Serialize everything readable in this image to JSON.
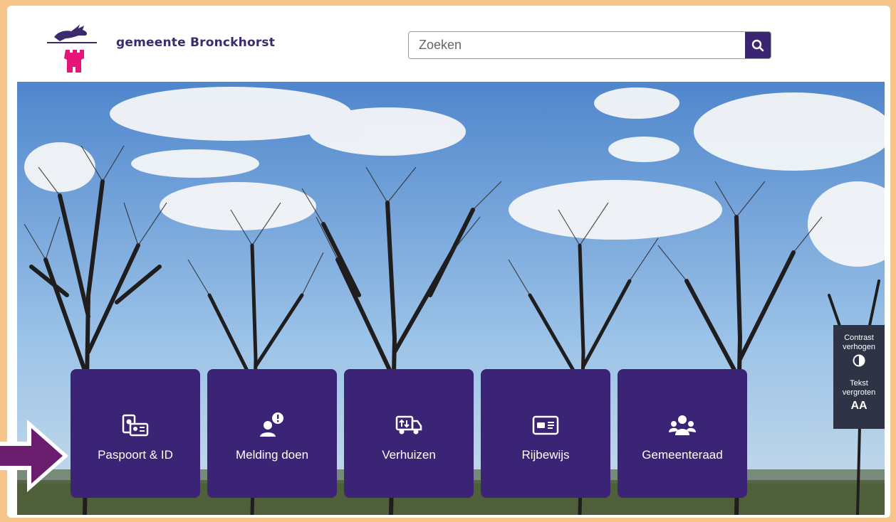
{
  "header": {
    "brand": "gemeente Bronckhorst",
    "search_placeholder": "Zoeken",
    "search_button_label": "Zoeken"
  },
  "tiles": [
    {
      "label": "Paspoort & ID",
      "icon": "passport-id-icon"
    },
    {
      "label": "Melding doen",
      "icon": "report-person-icon"
    },
    {
      "label": "Verhuizen",
      "icon": "moving-truck-icon"
    },
    {
      "label": "Rijbewijs",
      "icon": "drivers-license-icon"
    },
    {
      "label": "Gemeenteraad",
      "icon": "council-group-icon"
    }
  ],
  "accessibility": {
    "contrast_line1": "Contrast",
    "contrast_line2": "verhogen",
    "text_line1": "Tekst",
    "text_line2": "vergroten",
    "text_glyph": "AA"
  },
  "colors": {
    "brand_purple": "#3b2475",
    "frame_orange": "#f5c58a",
    "logo_pink": "#e5157a",
    "arrow_purple": "#6b1e6e"
  }
}
